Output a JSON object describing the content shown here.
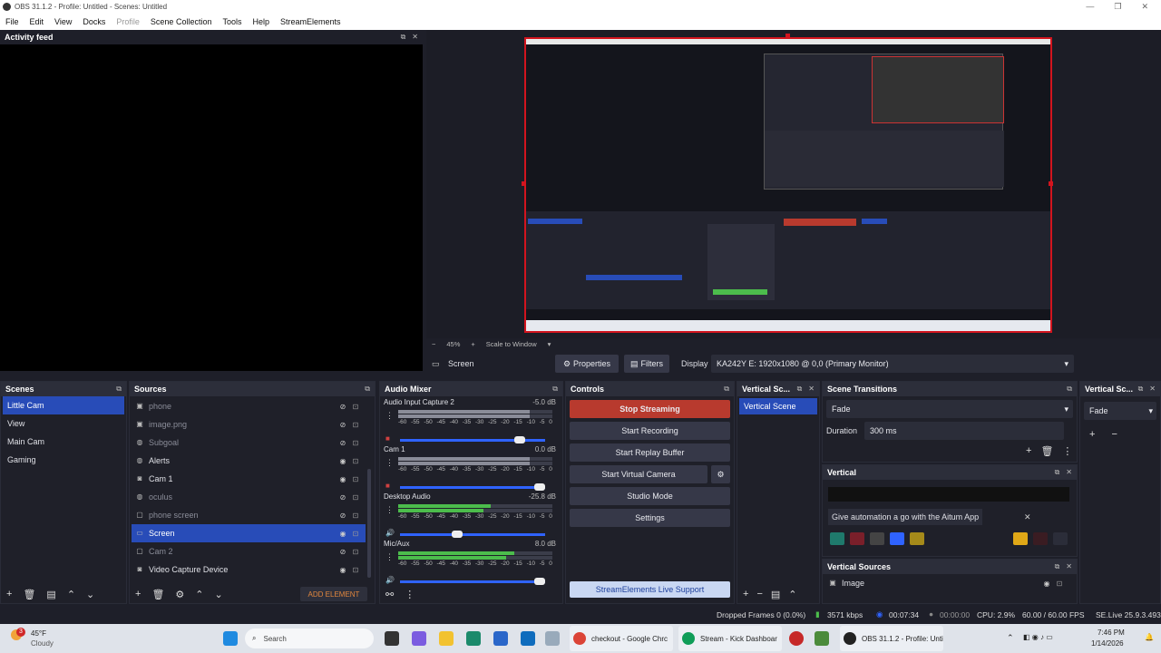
{
  "window": {
    "title": "OBS 31.1.2 - Profile: Untitled - Scenes: Untitled",
    "minimize": "—",
    "maximize": "❐",
    "close": "✕"
  },
  "menu": [
    "File",
    "Edit",
    "View",
    "Docks",
    "Profile",
    "Scene Collection",
    "Tools",
    "Help",
    "StreamElements"
  ],
  "activity_feed": {
    "title": "Activity feed"
  },
  "preview": {
    "zoom": "45%",
    "scale": "Scale to Window"
  },
  "source_bar": {
    "source": "Screen",
    "properties": "Properties",
    "filters": "Filters",
    "display_label": "Display",
    "display_value": "KA242Y E: 1920x1080 @ 0,0 (Primary Monitor)"
  },
  "scenes": {
    "title": "Scenes",
    "items": [
      "Little Cam",
      "View",
      "Main Cam",
      "Gaming"
    ],
    "selected": 0
  },
  "sources": {
    "title": "Sources",
    "add_element": "ADD ELEMENT",
    "items": [
      {
        "name": "phone",
        "icon": "image-icon",
        "visible": false
      },
      {
        "name": "image.png",
        "icon": "image-icon",
        "visible": false
      },
      {
        "name": "Subgoal",
        "icon": "browser-icon",
        "visible": false
      },
      {
        "name": "Alerts",
        "icon": "browser-icon",
        "visible": true
      },
      {
        "name": "Cam 1",
        "icon": "camera-icon",
        "visible": true
      },
      {
        "name": "oculus",
        "icon": "browser-icon",
        "visible": false
      },
      {
        "name": "phone screen",
        "icon": "window-icon",
        "visible": false
      },
      {
        "name": "Screen",
        "icon": "display-icon",
        "visible": true
      },
      {
        "name": "Cam 2",
        "icon": "window-icon",
        "visible": false
      },
      {
        "name": "Video Capture Device",
        "icon": "camera-icon",
        "visible": true
      }
    ]
  },
  "audio_mixer": {
    "title": "Audio Mixer",
    "scale": [
      "-60",
      "-55",
      "-50",
      "-45",
      "-40",
      "-35",
      "-30",
      "-25",
      "-20",
      "-15",
      "-10",
      "-5",
      "0"
    ],
    "channels": [
      {
        "name": "Audio Input Capture 2",
        "db": "-5.0 dB",
        "level": 0.86,
        "muted": true
      },
      {
        "name": "Cam 1",
        "db": "0.0 dB",
        "level": 1.0,
        "muted": true
      },
      {
        "name": "Desktop Audio",
        "db": "-25.8 dB",
        "level": 0.43,
        "muted": false
      },
      {
        "name": "Mic/Aux",
        "db": "8.0 dB",
        "level": 1.0,
        "muted": false
      }
    ]
  },
  "controls": {
    "title": "Controls",
    "stop_streaming": "Stop Streaming",
    "start_recording": "Start Recording",
    "start_replay": "Start Replay Buffer",
    "start_vcam": "Start Virtual Camera",
    "studio_mode": "Studio Mode",
    "settings": "Settings",
    "support": "StreamElements Live Support"
  },
  "vertical_scenes": {
    "title": "Vertical Sc...",
    "item": "Vertical Scene"
  },
  "scene_transitions": {
    "title": "Scene Transitions",
    "transition": "Fade",
    "duration_label": "Duration",
    "duration_value": "300 ms"
  },
  "vertical_sc2": {
    "title": "Vertical Sc...",
    "transition": "Fade"
  },
  "vertical": {
    "title": "Vertical",
    "banner": "Give automation a go with the Aitum App"
  },
  "vertical_sources": {
    "title": "Vertical Sources",
    "item": "Image"
  },
  "status": {
    "dropped": "Dropped Frames 0 (0.0%)",
    "kbps": "3571 kbps",
    "time": "00:07:34",
    "time2": "00:00:00",
    "cpu": "CPU: 2.9%",
    "fps": "60.00 / 60.00 FPS",
    "version": "SE.Live 25.9.3.493"
  },
  "taskbar": {
    "weather_temp": "45°F",
    "weather_desc": "Cloudy",
    "search": "Search",
    "app1": "checkout - Google Chrc",
    "app2": "Stream - Kick Dashboar",
    "app3": "OBS 31.1.2 - Profile: Unti",
    "time": "7:46 PM",
    "date": "1/14/2026",
    "badge": "3"
  },
  "colors": {
    "accent": "#284cb8",
    "stop": "#b83a2e",
    "panel": "#1f2029"
  }
}
